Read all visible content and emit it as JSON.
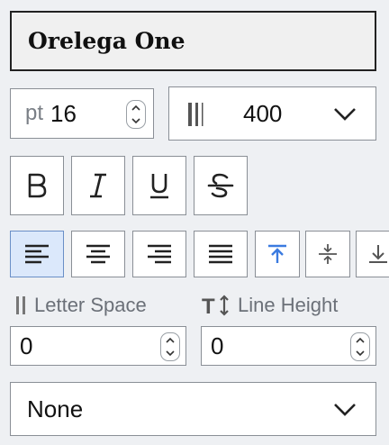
{
  "font": {
    "family": "Orelega One"
  },
  "size": {
    "unit": "pt",
    "value": "16"
  },
  "weight": {
    "value": "400"
  },
  "style_buttons": [
    "bold-button",
    "italic-button",
    "underline-button",
    "strikethrough-button"
  ],
  "letter_space": {
    "label": "Letter Space",
    "value": "0"
  },
  "line_height": {
    "label": "Line Height",
    "value": "0"
  },
  "text_transform": {
    "value": "None"
  },
  "colors": {
    "active_bg": "#dbe8fb",
    "accent": "#3b7be0",
    "border": "#8a8f96"
  }
}
